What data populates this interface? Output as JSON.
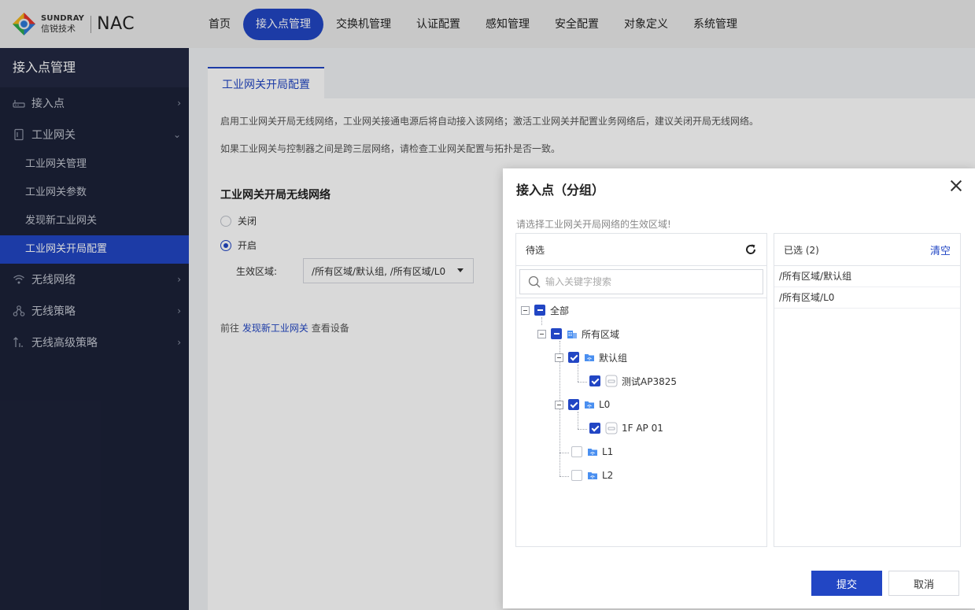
{
  "header": {
    "brand": "SUNDRAY",
    "brand_cn": "信锐技术",
    "product": "NAC",
    "nav": [
      {
        "label": "首页"
      },
      {
        "label": "接入点管理"
      },
      {
        "label": "交换机管理"
      },
      {
        "label": "认证配置"
      },
      {
        "label": "感知管理"
      },
      {
        "label": "安全配置"
      },
      {
        "label": "对象定义"
      },
      {
        "label": "系统管理"
      }
    ],
    "active_nav": "接入点管理"
  },
  "sidebar": {
    "title": "接入点管理",
    "items": [
      {
        "label": "接入点",
        "icon": "access-point-icon"
      },
      {
        "label": "工业网关",
        "icon": "gateway-icon",
        "expanded": true,
        "children": [
          {
            "label": "工业网关管理"
          },
          {
            "label": "工业网关参数"
          },
          {
            "label": "发现新工业网关"
          },
          {
            "label": "工业网关开局配置",
            "active": true
          }
        ]
      },
      {
        "label": "无线网络",
        "icon": "wifi-icon"
      },
      {
        "label": "无线策略",
        "icon": "policy-icon"
      },
      {
        "label": "无线高级策略",
        "icon": "advanced-policy-icon"
      }
    ]
  },
  "main": {
    "tab": "工业网关开局配置",
    "desc1": "启用工业网关开局无线网络，工业网关接通电源后将自动接入该网络；激活工业网关并配置业务网络后，建议关闭开局无线网络。",
    "desc2": "如果工业网关与控制器之间是跨三层网络，请检查工业网关配置与拓扑是否一致。",
    "section_title": "工业网关开局无线网络",
    "radio_off": "关闭",
    "radio_on": "开启",
    "radio_selected": "开启",
    "field_label": "生效区域:",
    "field_value": "/所有区域/默认组, /所有区域/L0",
    "goto_prefix": "前往",
    "goto_link": "发现新工业网关",
    "goto_suffix": "查看设备"
  },
  "modal": {
    "title": "接入点（分组）",
    "hint": "请选择工业网关开局网络的生效区域!",
    "left_title": "待选",
    "search_placeholder": "输入关键字搜索",
    "right_title": "已选 (2)",
    "clear_label": "清空",
    "tree": [
      {
        "label": "全部",
        "state": "partial",
        "level": 0,
        "expander": true
      },
      {
        "label": "所有区域",
        "state": "partial",
        "level": 1,
        "expander": true,
        "icon": "building-icon"
      },
      {
        "label": "默认组",
        "state": "checked",
        "level": 2,
        "expander": true,
        "icon": "folder-icon"
      },
      {
        "label": "测试AP3825",
        "state": "checked",
        "level": 3,
        "icon": "ap-device-icon"
      },
      {
        "label": "L0",
        "state": "checked",
        "level": 2,
        "expander": true,
        "icon": "folder-icon"
      },
      {
        "label": "1F AP 01",
        "state": "checked",
        "level": 3,
        "icon": "ap-device-icon"
      },
      {
        "label": "L1",
        "state": "unchecked",
        "level": 2,
        "icon": "folder-icon"
      },
      {
        "label": "L2",
        "state": "unchecked",
        "level": 2,
        "icon": "folder-icon"
      }
    ],
    "selected": [
      "/所有区域/默认组",
      "/所有区域/L0"
    ],
    "submit_label": "提交",
    "cancel_label": "取消"
  },
  "colors": {
    "accent": "#2246c4",
    "sidebar_bg": "#1c2238",
    "folder": "#4a8ff0"
  }
}
